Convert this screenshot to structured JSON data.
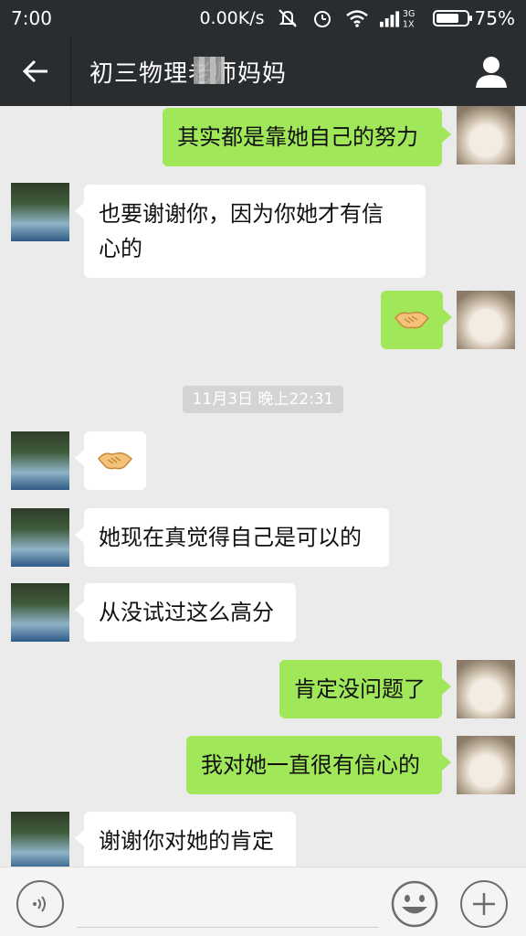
{
  "status_bar": {
    "time": "7:00",
    "network_speed": "0.00K/s",
    "signal_label": "3G 1X",
    "battery": "75%",
    "battery_level": 0.75
  },
  "header": {
    "title": "初三物理老师妈妈",
    "title_visible_prefix": "初三物理",
    "title_visible_suffix": "妈妈",
    "back_icon": "back-arrow-icon",
    "profile_icon": "person-icon"
  },
  "messages": [
    {
      "side": "out",
      "text": "其实都是靠她自己的努力"
    },
    {
      "side": "in",
      "text_line1": "也要谢谢你，因为你她才有信",
      "text_line2": "心的"
    },
    {
      "side": "out",
      "emoji": "handshake-icon"
    },
    {
      "timestamp": "11月3日 晚上22:31"
    },
    {
      "side": "in",
      "emoji": "handshake-icon"
    },
    {
      "side": "in",
      "text": "她现在真觉得自己是可以的"
    },
    {
      "side": "in",
      "text": "从没试过这么高分"
    },
    {
      "side": "out",
      "text": "肯定没问题了"
    },
    {
      "side": "out",
      "text": "我对她一直很有信心的"
    },
    {
      "side": "in",
      "text": "谢谢你对她的肯定"
    }
  ],
  "input_bar": {
    "voice_icon": "voice-icon",
    "emoji_icon": "emoji-icon",
    "plus_icon": "plus-icon",
    "input_value": ""
  },
  "colors": {
    "header_bg": "#2a2d30",
    "chat_bg": "#ebebeb",
    "outgoing_bubble": "#a0e75a",
    "incoming_bubble": "#ffffff"
  }
}
